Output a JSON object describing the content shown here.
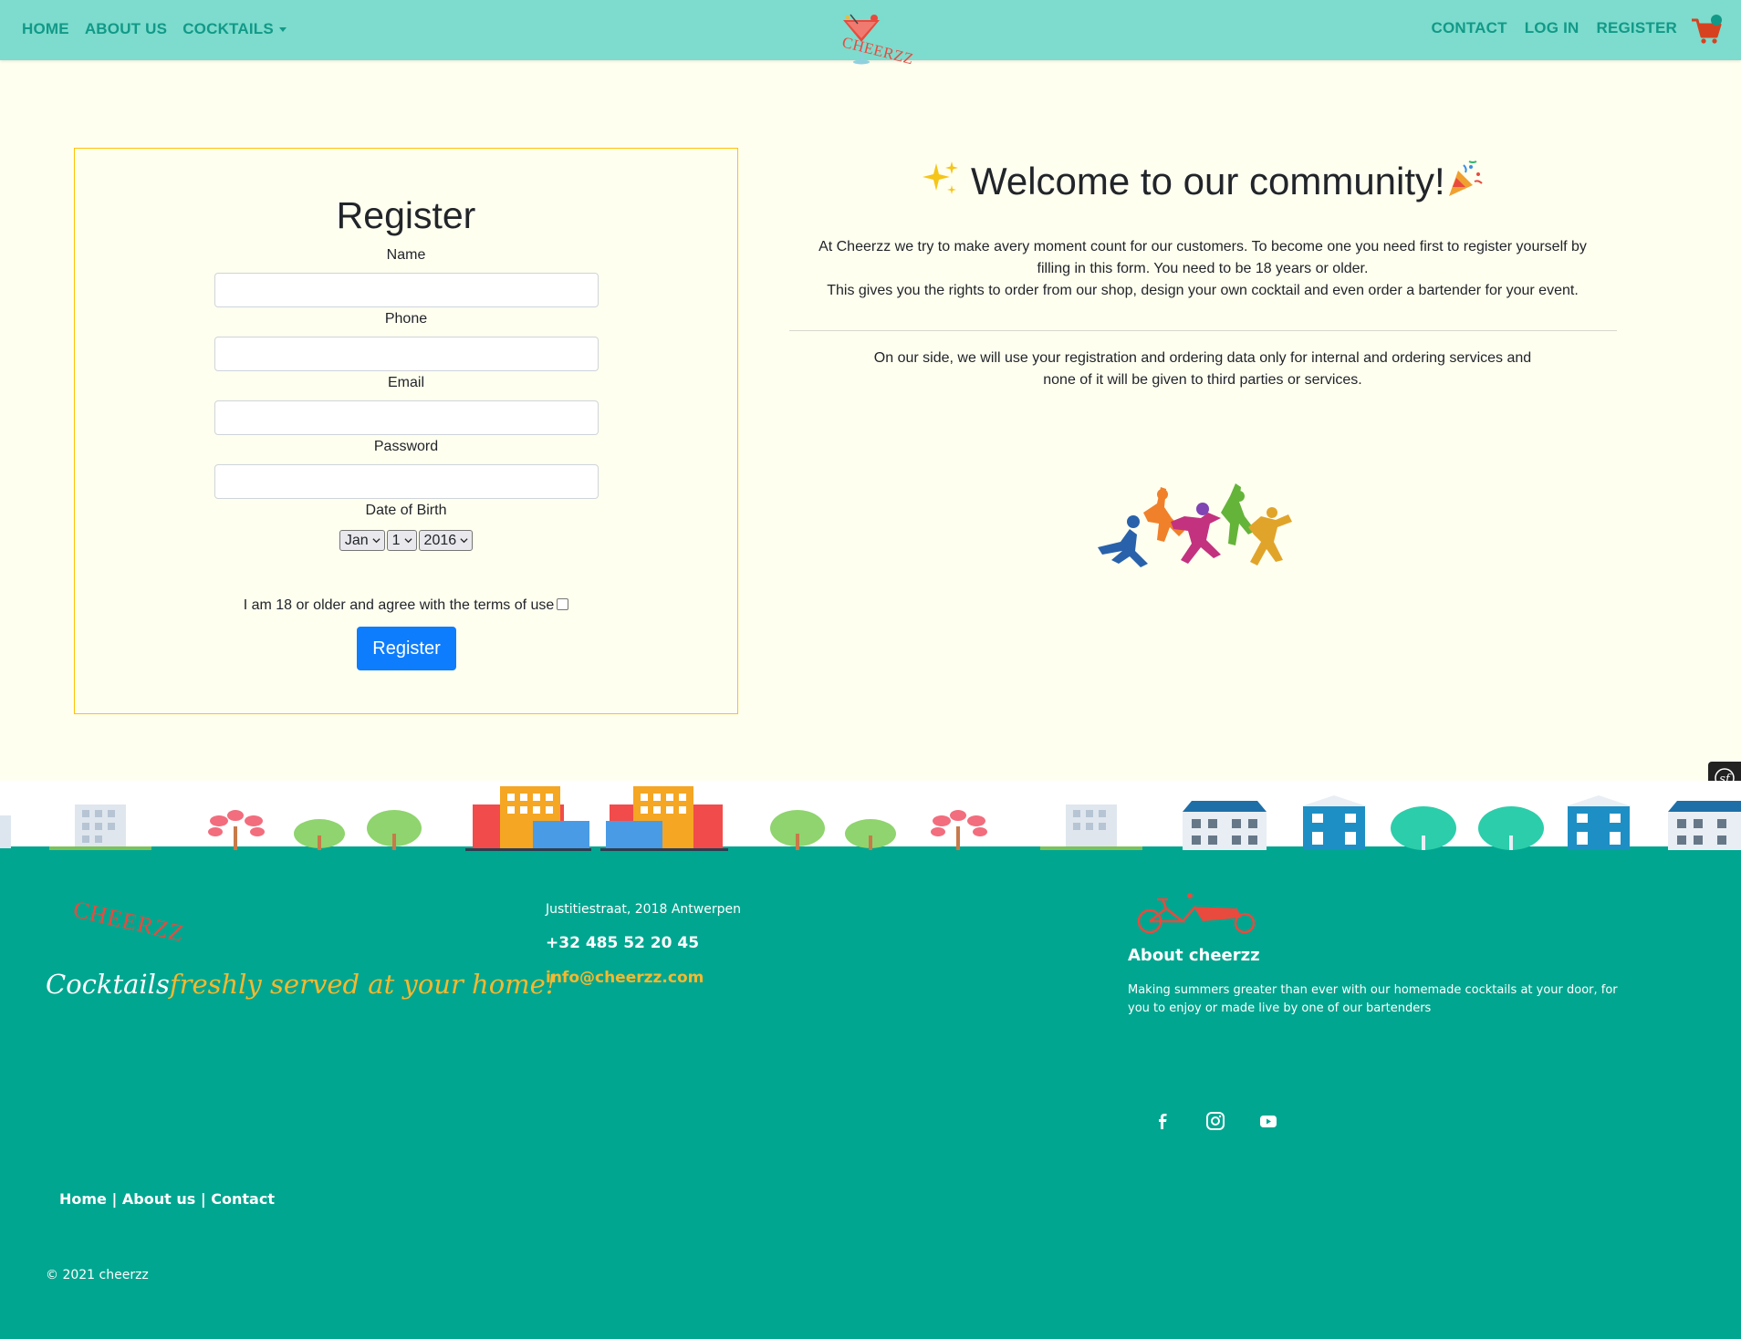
{
  "nav": {
    "home": "HOME",
    "about": "ABOUT US",
    "cocktails": "COCKTAILS",
    "contact": "CONTACT",
    "login": "LOG IN",
    "register": "REGISTER",
    "logo_text": "CHEERZZ",
    "cart_icon": "shopping-cart-icon"
  },
  "form": {
    "title": "Register",
    "name_label": "Name",
    "phone_label": "Phone",
    "email_label": "Email",
    "password_label": "Password",
    "dob_label": "Date of Birth",
    "dob_month": "Jan",
    "dob_day": "1",
    "dob_year": "2016",
    "terms_label": "I am 18 or older and agree with the terms of use",
    "submit_label": "Register",
    "border_color": "#ffc107",
    "button_color": "#0d7dfd"
  },
  "welcome": {
    "title": "Welcome to our community!",
    "intro_line1": "At Cheerzz we try to make avery moment count for our customers. To become one you need first to register yourself by filling in this form. You need to be 18 years or older.",
    "intro_line2": "This gives you the rights to order from our shop, design your own cocktail and even order a bartender for your event.",
    "privacy": "On our side, we will use your registration and ordering data only for internal and ordering services and none of it will be given to third parties or services."
  },
  "footer": {
    "logo_text": "CHEERZZ",
    "tagline_part1": "Cocktails",
    "tagline_part2": "freshly served at your home!",
    "address": "Justitiestraat, 2018 Antwerpen",
    "phone": "+32 485 52 20 45",
    "email": "info@cheerzz.com",
    "about_title": "About cheerzz",
    "about_text": "Making summers greater than ever with our homemade cocktails at your door, for you to enjoy or made live by one of our bartenders",
    "link_home": "Home",
    "link_about": "About us",
    "link_contact": "Contact",
    "separator": "|",
    "copyright": "© 2021 cheerzz",
    "social_icons": [
      "facebook-icon",
      "instagram-icon",
      "youtube-icon"
    ],
    "background_color": "#00a690",
    "accent_color": "#f5b82e"
  },
  "colors": {
    "navbar": "#7ddccd",
    "nav_link": "#129988",
    "page_background": "#fffff0"
  }
}
